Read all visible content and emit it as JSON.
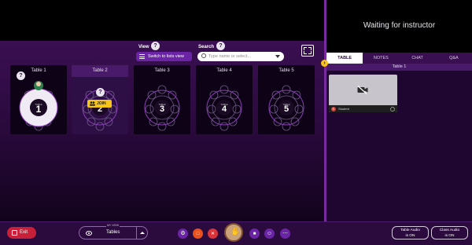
{
  "main": {
    "view_label": "View",
    "switch_label": "Switch to lists view",
    "search_label": "Search",
    "search_placeholder": "Type name or select...",
    "tables": [
      {
        "label": "Table 1",
        "number": "1",
        "seat_label": "TABLE"
      },
      {
        "label": "Table 2",
        "number": "2",
        "seat_label": "TABLE"
      },
      {
        "label": "Table 3",
        "number": "3",
        "seat_label": "TABLE"
      },
      {
        "label": "Table 4",
        "number": "4",
        "seat_label": "TABLE"
      },
      {
        "label": "Table 5",
        "number": "5",
        "seat_label": "TABLE"
      }
    ],
    "join_label": "JOIN"
  },
  "right_panel": {
    "waiting_text": "Waiting for instructor",
    "tabs": [
      "TABLE",
      "NOTES",
      "CHAT",
      "Q&A"
    ],
    "active_tab": "TABLE",
    "table_header": "Table 1",
    "participant_name": "Student",
    "participant_initial": "S"
  },
  "bottom": {
    "exit_label": "Exit",
    "my_view_label": "MY VIEW",
    "my_view_value": "Tables",
    "table_audio": "Table Audio",
    "table_audio_state": "is ON",
    "class_audio": "Class Audio",
    "class_audio_state": "is ON"
  },
  "colors": {
    "accent": "#6b24a6",
    "exit": "#c9203a",
    "join": "#f5c518",
    "button_orange": "#e8501e",
    "button_red": "#d9343a",
    "button_purple": "#6b24a6"
  }
}
